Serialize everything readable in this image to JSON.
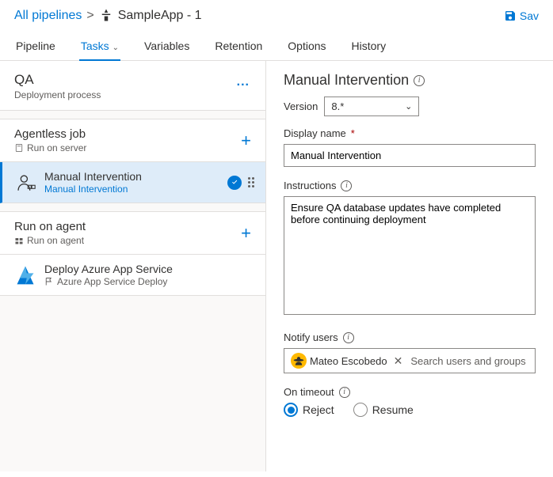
{
  "breadcrumb": {
    "root": "All pipelines",
    "title": "SampleApp - 1"
  },
  "header": {
    "save": "Sav"
  },
  "tabs": {
    "items": [
      {
        "label": "Pipeline"
      },
      {
        "label": "Tasks"
      },
      {
        "label": "Variables"
      },
      {
        "label": "Retention"
      },
      {
        "label": "Options"
      },
      {
        "label": "History"
      }
    ]
  },
  "stage": {
    "name": "QA",
    "subtitle": "Deployment process",
    "more": "..."
  },
  "groups": [
    {
      "title": "Agentless job",
      "subtitle": "Run on server",
      "subicon": "server",
      "tasks": [
        {
          "title": "Manual Intervention",
          "subtitle": "Manual Intervention",
          "icon": "person",
          "selected": true
        }
      ]
    },
    {
      "title": "Run on agent",
      "subtitle": "Run on agent",
      "subicon": "agent",
      "tasks": [
        {
          "title": "Deploy Azure App Service",
          "subtitle": "Azure App Service Deploy",
          "icon": "azure",
          "selected": false
        }
      ]
    }
  ],
  "panel": {
    "title": "Manual Intervention",
    "version_label": "Version",
    "version_value": "8.*",
    "display_name_label": "Display name",
    "display_name_value": "Manual Intervention",
    "instructions_label": "Instructions",
    "instructions_value": "Ensure QA database updates have completed before continuing deployment",
    "notify_label": "Notify users",
    "notify_chip": "Mateo Escobedo",
    "notify_placeholder": "Search users and groups",
    "timeout_label": "On timeout",
    "timeout_options": {
      "reject": "Reject",
      "resume": "Resume"
    },
    "timeout_selected": "reject"
  }
}
